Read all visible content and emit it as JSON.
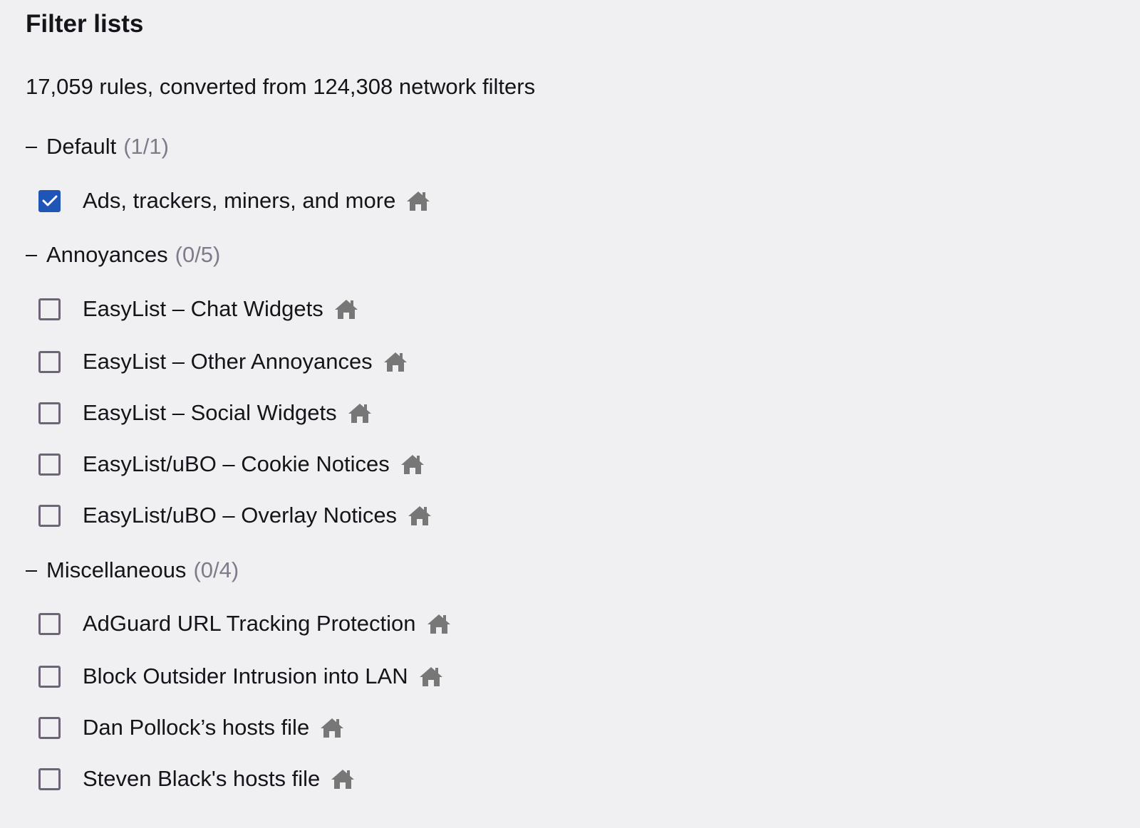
{
  "page": {
    "title": "Filter lists",
    "summary": "17,059 rules, converted from 124,308 network filters"
  },
  "colors": {
    "background": "#f0f0f2",
    "text": "#15141a",
    "muted": "#807a8a",
    "checkbox_checked": "#2055b8",
    "checkbox_border": "#6d6478",
    "home_icon": "#777777"
  },
  "groups": [
    {
      "name": "Default",
      "count": "(1/1)",
      "expanded": true,
      "toggle_icon": "minus-icon",
      "lists": [
        {
          "label": "Ads, trackers, miners, and more",
          "checked": true,
          "icon": "home-icon"
        }
      ]
    },
    {
      "name": "Annoyances",
      "count": "(0/5)",
      "expanded": true,
      "toggle_icon": "minus-icon",
      "lists": [
        {
          "label": "EasyList – Chat Widgets",
          "checked": false,
          "icon": "home-icon"
        },
        {
          "label": "EasyList – Other Annoyances",
          "checked": false,
          "icon": "home-icon"
        },
        {
          "label": "EasyList – Social Widgets",
          "checked": false,
          "icon": "home-icon"
        },
        {
          "label": "EasyList/uBO – Cookie Notices",
          "checked": false,
          "icon": "home-icon"
        },
        {
          "label": "EasyList/uBO – Overlay Notices",
          "checked": false,
          "icon": "home-icon"
        }
      ]
    },
    {
      "name": "Miscellaneous",
      "count": "(0/4)",
      "expanded": true,
      "toggle_icon": "minus-icon",
      "lists": [
        {
          "label": "AdGuard URL Tracking Protection",
          "checked": false,
          "icon": "home-icon"
        },
        {
          "label": "Block Outsider Intrusion into LAN",
          "checked": false,
          "icon": "home-icon"
        },
        {
          "label": "Dan Pollock’s hosts file",
          "checked": false,
          "icon": "home-icon"
        },
        {
          "label": "Steven Black's hosts file",
          "checked": false,
          "icon": "home-icon"
        }
      ]
    }
  ]
}
